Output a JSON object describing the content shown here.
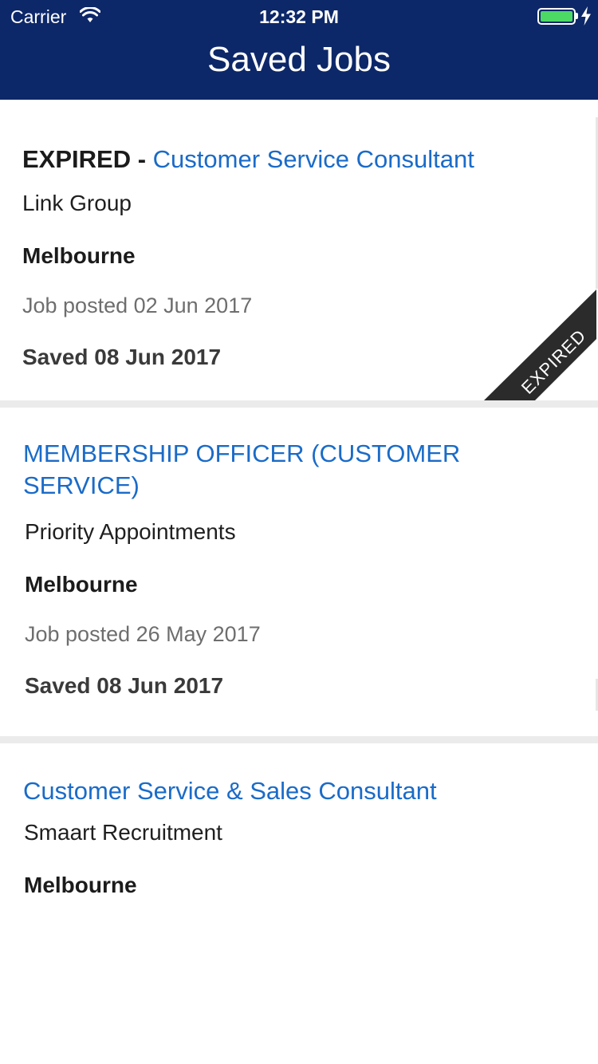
{
  "status_bar": {
    "carrier": "Carrier",
    "time": "12:32 PM",
    "battery_color": "#4cd964"
  },
  "nav": {
    "title": "Saved Jobs",
    "background": "#0d2869"
  },
  "jobs": [
    {
      "status_prefix": "EXPIRED - ",
      "title": "Customer Service Consultant",
      "company": "Link Group",
      "location": "Melbourne",
      "posted": "Job posted 02 Jun 2017",
      "saved": "Saved 08 Jun 2017",
      "ribbon": "EXPIRED"
    },
    {
      "title_line1": "MEMBERSHIP OFFICER (CUSTOMER",
      "title_line2": "SERVICE)",
      "company": "Priority Appointments",
      "location": "Melbourne",
      "posted": "Job posted 26 May 2017",
      "saved": "Saved 08 Jun 2017"
    },
    {
      "title": "Customer Service & Sales Consultant",
      "company": "Smaart Recruitment",
      "location": "Melbourne"
    }
  ],
  "colors": {
    "link": "#1a6bc8",
    "separator": "#ebebeb"
  }
}
